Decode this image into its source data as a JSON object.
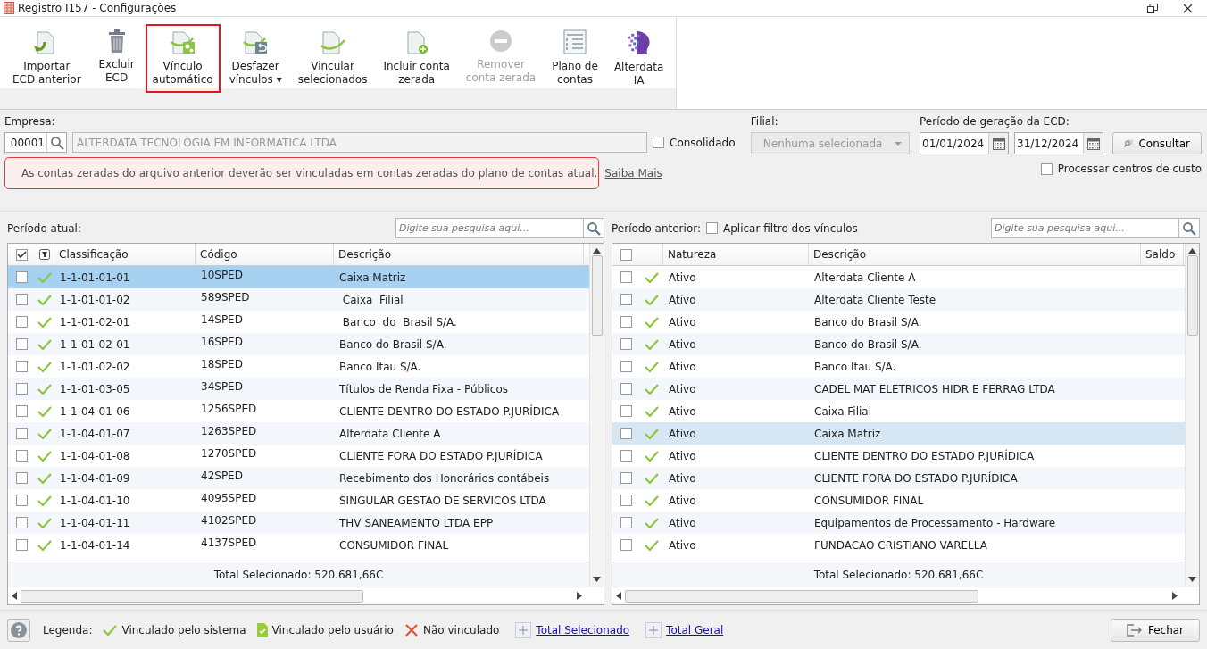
{
  "window": {
    "title": "Registro I157 - Configurações"
  },
  "toolbar": [
    {
      "label": "Importar\nECD anterior",
      "kind": "import",
      "disabled": false,
      "highlighted": false
    },
    {
      "label": "Excluir\nECD",
      "kind": "trash",
      "disabled": false,
      "highlighted": false
    },
    {
      "label": "Vínculo\nautomático",
      "kind": "auto",
      "disabled": false,
      "highlighted": true
    },
    {
      "label": "Desfazer\nvínculos ▾",
      "kind": "undo",
      "disabled": false,
      "highlighted": false
    },
    {
      "label": "Vincular\nselecionados",
      "kind": "link",
      "disabled": false,
      "highlighted": false
    },
    {
      "label": "Incluir conta\nzerada",
      "kind": "add",
      "disabled": false,
      "highlighted": false
    },
    {
      "label": "Remover\nconta zerada",
      "kind": "remove",
      "disabled": true,
      "highlighted": false
    },
    {
      "label": "Plano de\ncontas",
      "kind": "list",
      "disabled": false,
      "highlighted": false
    },
    {
      "label": "Alterdata\nIA",
      "kind": "ai",
      "disabled": false,
      "highlighted": false
    }
  ],
  "form": {
    "empresa_label": "Empresa:",
    "empresa_code": "00001",
    "empresa_name": "ALTERDATA TECNOLOGIA EM INFORMATICA LTDA",
    "consolidado": {
      "label": "Consolidado",
      "checked": false
    },
    "filial_label": "Filial:",
    "filial_placeholder": "Nenhuma selecionada",
    "periodo_label": "Período de geração da ECD:",
    "date_from": "01/01/2024",
    "date_to": "31/12/2024",
    "consultar": "Consultar",
    "centros": {
      "label": "Processar centros de custo",
      "checked": false
    },
    "alert": "As contas zeradas do arquivo anterior deverão ser vinculadas em contas zeradas do plano de contas atual.",
    "alert_link": "Saiba Mais"
  },
  "left": {
    "title": "Período atual:",
    "search_placeholder": "Digite sua pesquisa aqui...",
    "all_checked": true,
    "columns": [
      "Classificação",
      "Código",
      "Descrição"
    ],
    "rows": [
      {
        "checked": false,
        "selected": true,
        "kind": "system",
        "cells": [
          "1-1-01-01-01",
          "10SPED",
          "Caixa Matriz"
        ]
      },
      {
        "checked": false,
        "selected": false,
        "kind": "system",
        "cells": [
          "1-1-01-01-02",
          "589SPED",
          " Caixa  Filial"
        ]
      },
      {
        "checked": false,
        "selected": false,
        "kind": "system",
        "cells": [
          "1-1-01-02-01",
          "14SPED",
          " Banco  do  Brasil S/A."
        ]
      },
      {
        "checked": false,
        "selected": false,
        "kind": "system",
        "cells": [
          "1-1-01-02-01",
          "16SPED",
          "Banco do Brasil S/A."
        ]
      },
      {
        "checked": false,
        "selected": false,
        "kind": "system",
        "cells": [
          "1-1-01-02-02",
          "18SPED",
          "Banco Itau S/A."
        ]
      },
      {
        "checked": false,
        "selected": false,
        "kind": "system",
        "cells": [
          "1-1-01-03-05",
          "34SPED",
          "Títulos de Renda Fixa - Públicos"
        ]
      },
      {
        "checked": false,
        "selected": false,
        "kind": "system",
        "cells": [
          "1-1-04-01-06",
          "1256SPED",
          "CLIENTE DENTRO DO ESTADO P.JURÍDICA"
        ]
      },
      {
        "checked": false,
        "selected": false,
        "kind": "system",
        "cells": [
          "1-1-04-01-07",
          "1263SPED",
          "Alterdata Cliente A"
        ]
      },
      {
        "checked": false,
        "selected": false,
        "kind": "system",
        "cells": [
          "1-1-04-01-08",
          "1270SPED",
          "CLIENTE FORA DO ESTADO P.JURÍDICA"
        ]
      },
      {
        "checked": false,
        "selected": false,
        "kind": "system",
        "cells": [
          "1-1-04-01-09",
          "42SPED",
          "Recebimento dos Honorários contábeis"
        ]
      },
      {
        "checked": false,
        "selected": false,
        "kind": "system",
        "cells": [
          "1-1-04-01-10",
          "4095SPED",
          "SINGULAR GESTAO DE SERVICOS LTDA"
        ]
      },
      {
        "checked": false,
        "selected": false,
        "kind": "system",
        "cells": [
          "1-1-04-01-11",
          "4102SPED",
          "THV SANEAMENTO LTDA EPP"
        ]
      },
      {
        "checked": false,
        "selected": false,
        "kind": "system",
        "cells": [
          "1-1-04-01-14",
          "4137SPED",
          "CONSUMIDOR FINAL"
        ]
      }
    ],
    "total": "Total Selecionado: 520.681,66C"
  },
  "right": {
    "title": "Período anterior:",
    "filter": {
      "label": "Aplicar filtro dos vínculos",
      "checked": false
    },
    "search_placeholder": "Digite sua pesquisa aqui...",
    "all_checked": false,
    "columns": [
      "Natureza",
      "Descrição",
      "Saldo"
    ],
    "rows": [
      {
        "checked": false,
        "selected": false,
        "kind": "system",
        "cells": [
          "Ativo",
          "Alterdata Cliente A"
        ]
      },
      {
        "checked": false,
        "selected": false,
        "kind": "system",
        "cells": [
          "Ativo",
          "Alterdata Cliente Teste"
        ]
      },
      {
        "checked": false,
        "selected": false,
        "kind": "system",
        "cells": [
          "Ativo",
          "Banco do Brasil S/A."
        ]
      },
      {
        "checked": false,
        "selected": false,
        "kind": "system",
        "cells": [
          "Ativo",
          "Banco do Brasil S/A."
        ]
      },
      {
        "checked": false,
        "selected": false,
        "kind": "system",
        "cells": [
          "Ativo",
          "Banco Itau S/A."
        ]
      },
      {
        "checked": false,
        "selected": false,
        "kind": "system",
        "cells": [
          "Ativo",
          "CADEL MAT ELETRICOS HIDR E FERRAG LTDA"
        ]
      },
      {
        "checked": false,
        "selected": false,
        "kind": "system",
        "cells": [
          "Ativo",
          "Caixa Filial"
        ]
      },
      {
        "checked": false,
        "selected": true,
        "kind": "system",
        "cells": [
          "Ativo",
          "Caixa Matriz"
        ]
      },
      {
        "checked": false,
        "selected": false,
        "kind": "system",
        "cells": [
          "Ativo",
          "CLIENTE DENTRO DO ESTADO P.JURÍDICA"
        ]
      },
      {
        "checked": false,
        "selected": false,
        "kind": "system",
        "cells": [
          "Ativo",
          "CLIENTE FORA DO ESTADO P.JURÍDICA"
        ]
      },
      {
        "checked": false,
        "selected": false,
        "kind": "system",
        "cells": [
          "Ativo",
          "CONSUMIDOR FINAL"
        ]
      },
      {
        "checked": false,
        "selected": false,
        "kind": "system",
        "cells": [
          "Ativo",
          "Equipamentos de Processamento - Hardware"
        ]
      },
      {
        "checked": false,
        "selected": false,
        "kind": "system",
        "cells": [
          "Ativo",
          "FUNDACAO CRISTIANO VARELLA"
        ]
      }
    ],
    "total": "Total Selecionado: 520.681,66C"
  },
  "footer": {
    "legend_label": "Legenda:",
    "legend": [
      {
        "kind": "system",
        "label": "Vinculado pelo sistema"
      },
      {
        "kind": "user",
        "label": "Vinculado pelo usuário"
      },
      {
        "kind": "none",
        "label": "Não vinculado"
      }
    ],
    "links": [
      "Total Selecionado",
      "Total Geral"
    ],
    "close": "Fechar"
  }
}
